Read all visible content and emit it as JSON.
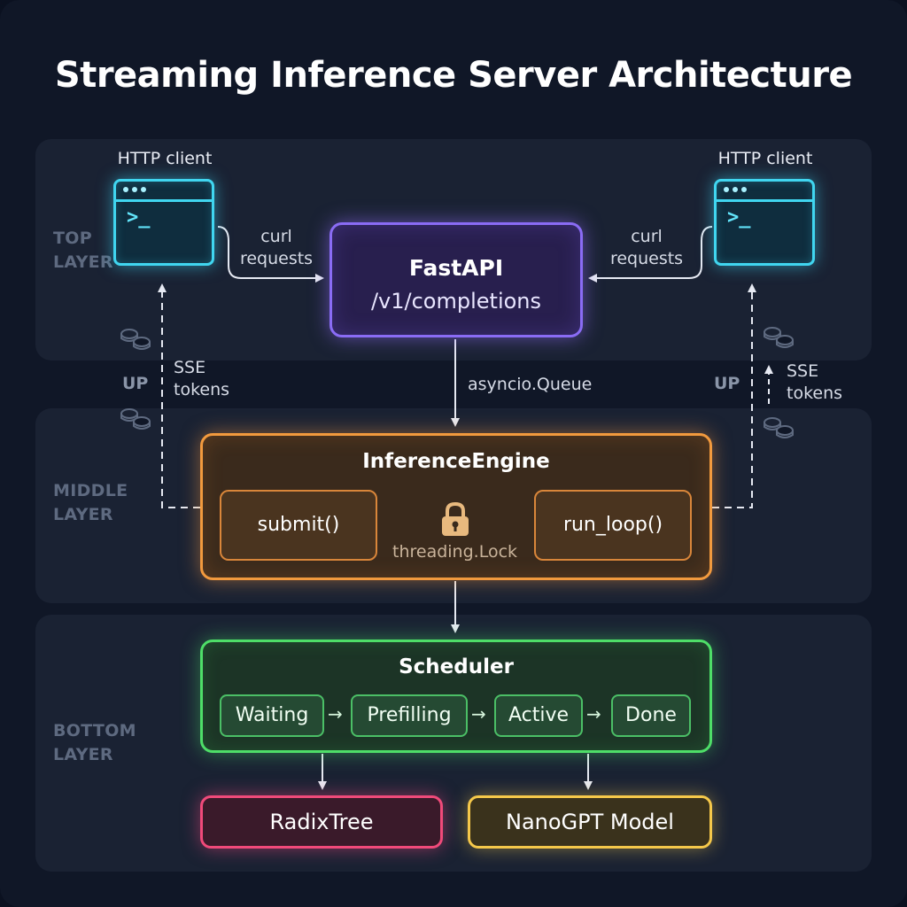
{
  "title": "Streaming Inference Server Architecture",
  "layers": {
    "top": [
      "TOP",
      "LAYER"
    ],
    "middle": [
      "MIDDLE",
      "LAYER"
    ],
    "bottom": [
      "BOTTOM",
      "LAYER"
    ]
  },
  "clients": {
    "left_label": "HTTP client",
    "right_label": "HTTP client",
    "prompt": ">_"
  },
  "edges": {
    "curl_left": [
      "curl",
      "requests"
    ],
    "curl_right": [
      "curl",
      "requests"
    ],
    "sse_left": [
      "SSE",
      "tokens"
    ],
    "sse_right": [
      "SSE",
      "tokens"
    ],
    "up_left": "UP",
    "up_right": "UP",
    "queue": "asyncio.Queue",
    "lock": "threading.Lock"
  },
  "fastapi": {
    "name": "FastAPI",
    "route": "/v1/completions"
  },
  "engine": {
    "name": "InferenceEngine",
    "submit": "submit()",
    "run_loop": "run_loop()"
  },
  "scheduler": {
    "name": "Scheduler",
    "states": [
      "Waiting",
      "Prefilling",
      "Active",
      "Done"
    ],
    "arrow": "→"
  },
  "radix": "RadixTree",
  "model": "NanoGPT Model",
  "colors": {
    "cyan": "#40d6f0",
    "purple": "#8a6cf5",
    "orange": "#f29a3e",
    "green": "#4ede68",
    "pink": "#f04a7a",
    "gold": "#f5c84a"
  }
}
